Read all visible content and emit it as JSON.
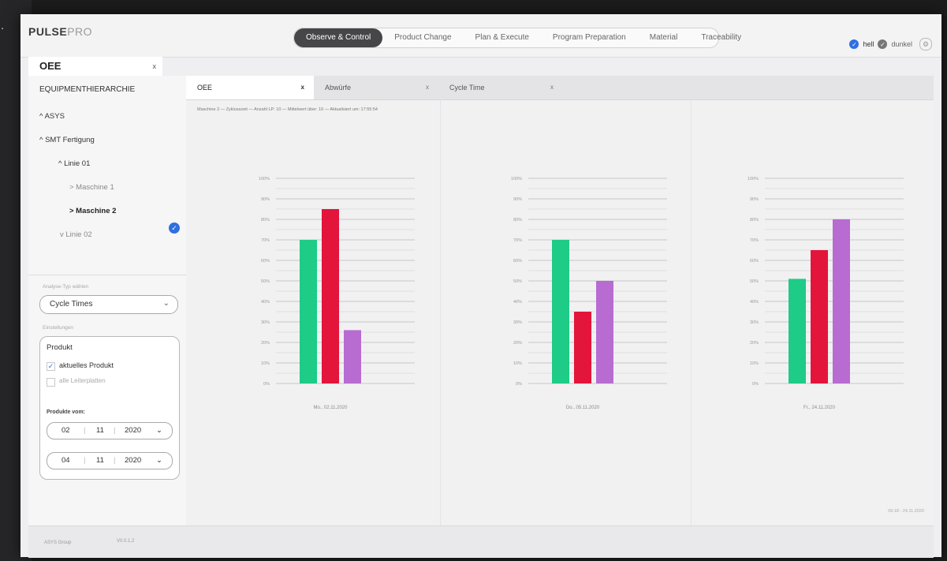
{
  "app": {
    "logo_main": "PULSE",
    "logo_pro": "PRO"
  },
  "nav": [
    "Observe & Control",
    "Product Change",
    "Plan & Execute",
    "Program Preparation",
    "Material",
    "Traceability"
  ],
  "theme": {
    "light_label": "hell",
    "dark_label": "dunkel"
  },
  "oee_tab": {
    "label": "OEE",
    "close": "x"
  },
  "sidebar": {
    "heading": "EQUIPMENTHIERARCHIE",
    "tree": [
      "^ ASYS",
      "^ SMT Fertigung",
      "^ Linie 01",
      "> Maschine 1",
      "> Maschine 2",
      "v Linie 02"
    ],
    "analysis_label": "Analyse-Typ wählen",
    "analysis_value": "Cycle Times",
    "settings_label": "Einstellungen",
    "product_title": "Produkt",
    "cb_current": "aktuelles Produkt",
    "cb_all": "alle Leiterplatten",
    "products_from": "Produkte vom:",
    "date1": {
      "day": "02",
      "month": "11",
      "year": "2020"
    },
    "date2": {
      "day": "04",
      "month": "11",
      "year": "2020"
    }
  },
  "tabs": [
    {
      "label": "OEE",
      "close": "x"
    },
    {
      "label": "Abwürfe",
      "close": "x"
    },
    {
      "label": "Cycle Time",
      "close": "x"
    }
  ],
  "info_line": "Maschine 2 — Zyklusszeit — Anzahl LP: 10 — Mittelwert über: 10 — Aktualisiert um: 17:55:54",
  "footer": {
    "company": "ASYS Group",
    "version": "V0.0.1.2",
    "date": "09:18 - 24.11.2020"
  },
  "colors": {
    "green": "#1ecb87",
    "red": "#e3153b",
    "purple": "#b86bd1"
  },
  "chart_data": [
    {
      "type": "bar",
      "xlabel": "Mo., 02.11.2020",
      "ylim": [
        0,
        100
      ],
      "ticks": [
        "0%",
        "10%",
        "20%",
        "30%",
        "40%",
        "50%",
        "60%",
        "70%",
        "80%",
        "90%",
        "100%"
      ],
      "values": [
        70,
        85,
        26
      ]
    },
    {
      "type": "bar",
      "xlabel": "Do., 05.11.2020",
      "ylim": [
        0,
        100
      ],
      "ticks": [
        "0%",
        "10%",
        "20%",
        "30%",
        "40%",
        "50%",
        "60%",
        "70%",
        "80%",
        "90%",
        "100%"
      ],
      "values": [
        70,
        35,
        50
      ]
    },
    {
      "type": "bar",
      "xlabel": "Fr., 24.11.2020",
      "ylim": [
        0,
        100
      ],
      "ticks": [
        "0%",
        "10%",
        "20%",
        "30%",
        "40%",
        "50%",
        "60%",
        "70%",
        "80%",
        "90%",
        "100%"
      ],
      "values": [
        51,
        65,
        80
      ]
    }
  ]
}
